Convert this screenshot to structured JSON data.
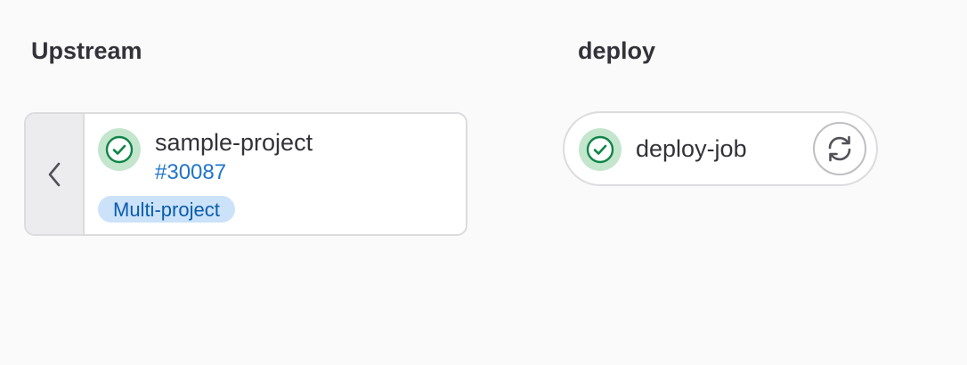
{
  "upstream_stage": {
    "title": "Upstream",
    "card": {
      "project_name": "sample-project",
      "pipeline_id": "#30087",
      "type_badge": "Multi-project",
      "status": "success",
      "collapse_icon": "chevron-left-icon"
    }
  },
  "deploy_stage": {
    "title": "deploy",
    "job": {
      "name": "deploy-job",
      "status": "success",
      "action_icon": "retry-icon"
    }
  },
  "colors": {
    "success": "#108548",
    "success_bg": "#c3e6cd",
    "link": "#1f75cb",
    "badge_bg": "#cbe2f9",
    "badge_text": "#0b5cad",
    "border": "#dcdcde"
  }
}
